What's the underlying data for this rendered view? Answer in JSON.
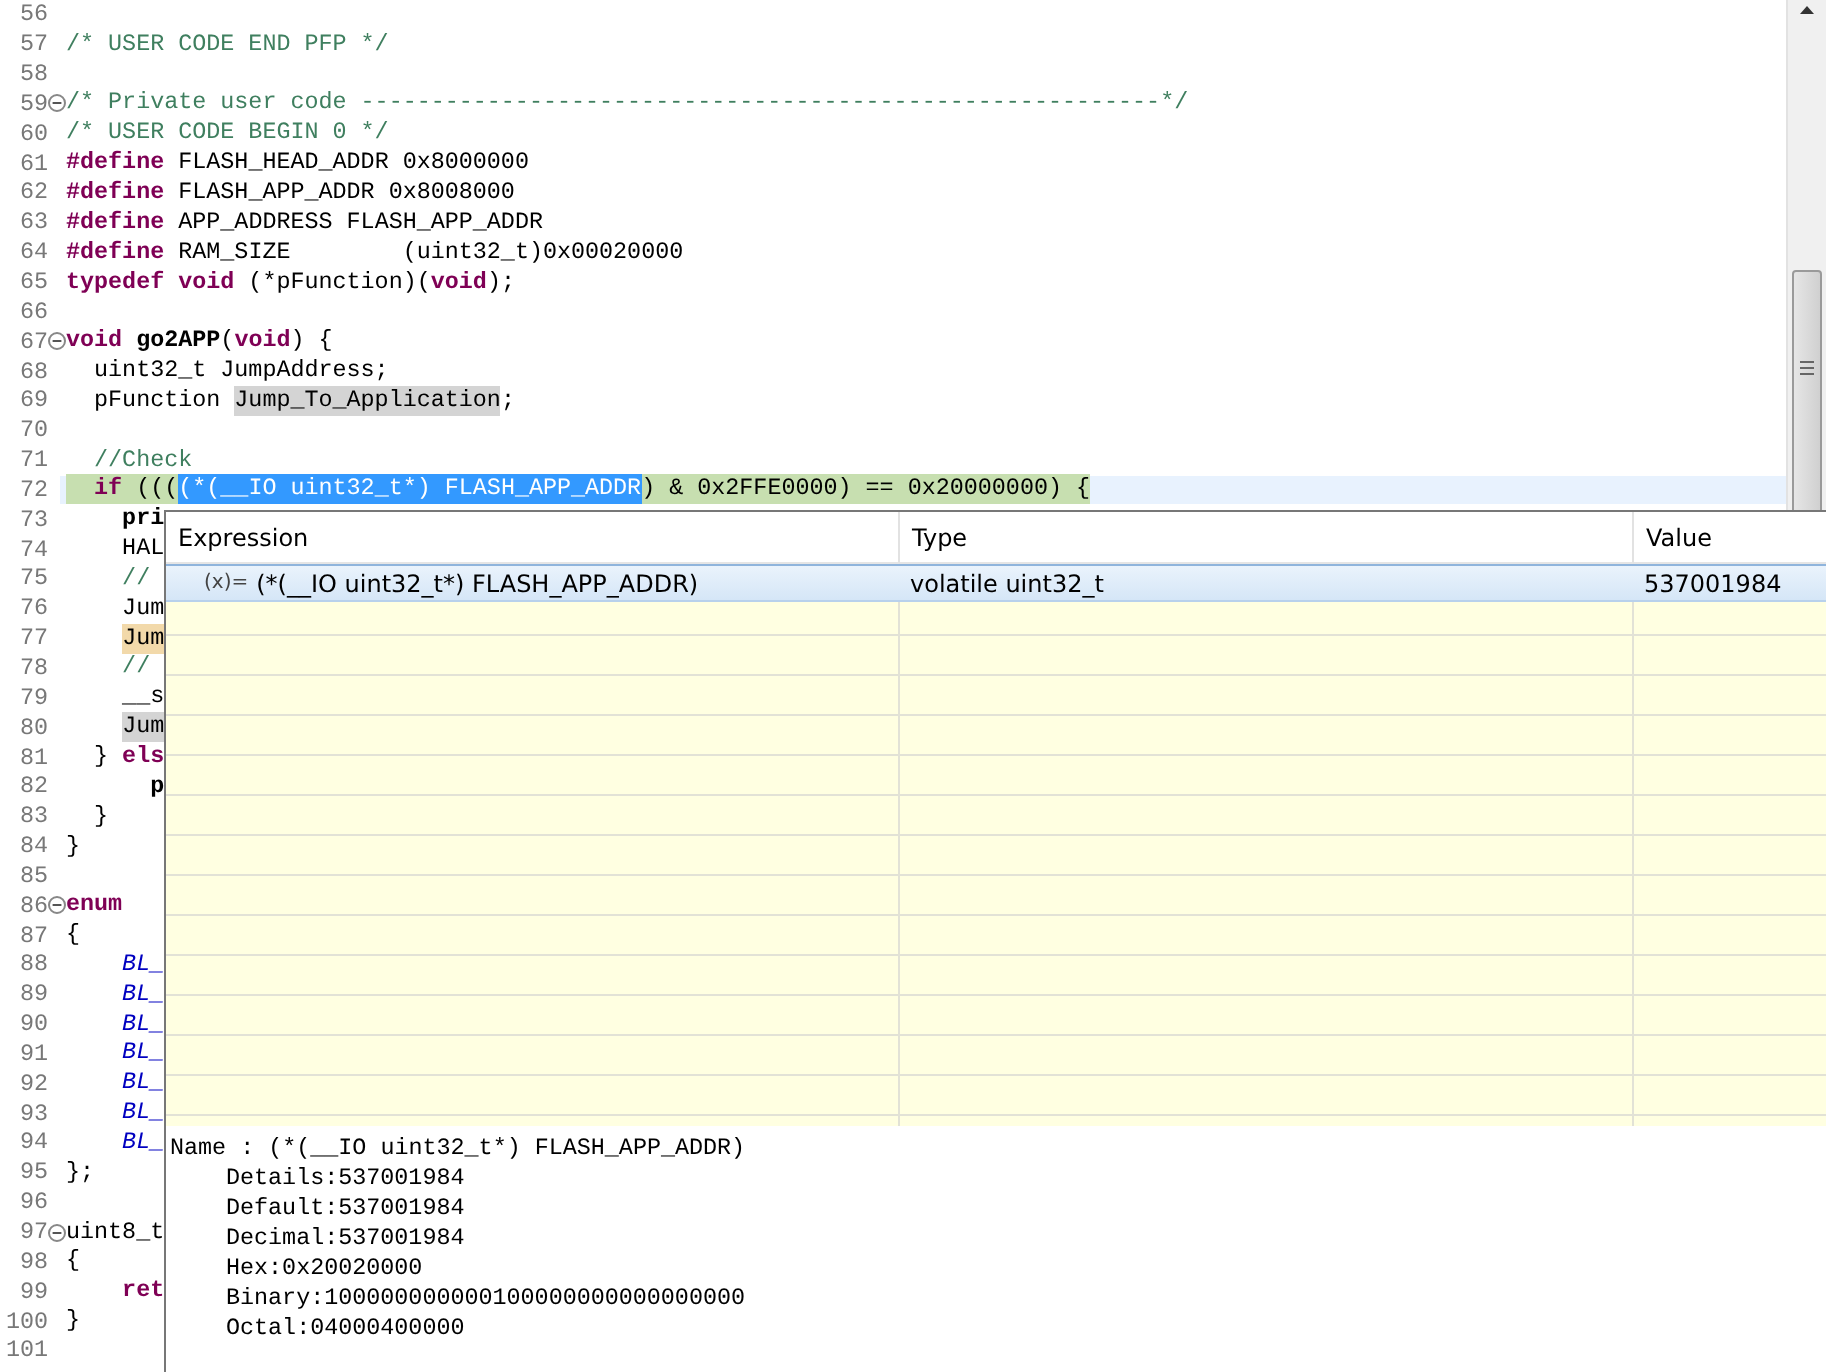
{
  "editor": {
    "lines": [
      {
        "number": "56",
        "fold": false,
        "current": false
      },
      {
        "number": "57",
        "fold": false,
        "current": false,
        "segments": [
          {
            "text": "/* USER CODE END PFP */",
            "kind": "comment"
          }
        ]
      },
      {
        "number": "58",
        "fold": false,
        "current": false
      },
      {
        "number": "59",
        "fold": true,
        "current": false,
        "segments": [
          {
            "text": "/* Private user code ---------------------------------------------------------*/",
            "kind": "comment"
          }
        ]
      },
      {
        "number": "60",
        "fold": false,
        "current": false,
        "segments": [
          {
            "text": "/* USER CODE BEGIN 0 */",
            "kind": "comment"
          }
        ]
      },
      {
        "number": "61",
        "fold": false,
        "current": false,
        "segments": [
          {
            "text": "#define",
            "kind": "keyword"
          },
          {
            "text": " FLASH_HEAD_ADDR 0x8000000",
            "kind": "plain"
          }
        ]
      },
      {
        "number": "62",
        "fold": false,
        "current": false,
        "segments": [
          {
            "text": "#define",
            "kind": "keyword"
          },
          {
            "text": " FLASH_APP_ADDR 0x8008000",
            "kind": "plain"
          }
        ]
      },
      {
        "number": "63",
        "fold": false,
        "current": false,
        "segments": [
          {
            "text": "#define",
            "kind": "keyword"
          },
          {
            "text": " APP_ADDRESS FLASH_APP_ADDR",
            "kind": "plain"
          }
        ]
      },
      {
        "number": "64",
        "fold": false,
        "current": false,
        "segments": [
          {
            "text": "#define",
            "kind": "keyword"
          },
          {
            "text": " RAM_SIZE        (uint32_t)0x00020000",
            "kind": "plain"
          }
        ]
      },
      {
        "number": "65",
        "fold": false,
        "current": false,
        "segments": [
          {
            "text": "typedef void",
            "kind": "keyword"
          },
          {
            "text": " (*pFunction)(",
            "kind": "plain"
          },
          {
            "text": "void",
            "kind": "keyword"
          },
          {
            "text": ");",
            "kind": "plain"
          }
        ]
      },
      {
        "number": "66",
        "fold": false,
        "current": false
      },
      {
        "number": "67",
        "fold": true,
        "current": false,
        "segments": [
          {
            "text": "void",
            "kind": "keyword"
          },
          {
            "text": " go2APP",
            "kind": "function"
          },
          {
            "text": "(",
            "kind": "plain"
          },
          {
            "text": "void",
            "kind": "keyword"
          },
          {
            "text": ") {",
            "kind": "plain"
          }
        ]
      },
      {
        "number": "68",
        "fold": false,
        "current": false,
        "segments": [
          {
            "text": "  uint32_t JumpAddress;",
            "kind": "plain"
          }
        ]
      },
      {
        "number": "69",
        "fold": false,
        "current": false,
        "segments": [
          {
            "text": "  pFunction ",
            "kind": "plain"
          },
          {
            "text": "Jump_To_Application",
            "kind": "plain",
            "occurrence": true
          },
          {
            "text": ";",
            "kind": "plain"
          }
        ]
      },
      {
        "number": "70",
        "fold": false,
        "current": false
      },
      {
        "number": "71",
        "fold": false,
        "current": false,
        "segments": [
          {
            "text": "  //Check",
            "kind": "comment"
          }
        ]
      },
      {
        "number": "72",
        "fold": false,
        "current": true,
        "segments": [
          {
            "text": "  if",
            "kind": "keyword",
            "matched": true
          },
          {
            "text": " (((",
            "kind": "plain",
            "matched": true
          },
          {
            "text": "(*(__IO uint32_t*) FLASH_APP_ADDR",
            "kind": "plain",
            "selected": true
          },
          {
            "text": ") & 0x2FFE0000) == 0x20000000) {",
            "kind": "plain",
            "matched": true
          }
        ]
      },
      {
        "number": "73",
        "fold": false,
        "current": false,
        "segments": [
          {
            "text": "    pri",
            "kind": "function"
          }
        ]
      },
      {
        "number": "74",
        "fold": false,
        "current": false,
        "segments": [
          {
            "text": "    HAL",
            "kind": "plain"
          }
        ]
      },
      {
        "number": "75",
        "fold": false,
        "current": false,
        "segments": [
          {
            "text": "    //",
            "kind": "comment"
          }
        ]
      },
      {
        "number": "76",
        "fold": false,
        "current": false,
        "segments": [
          {
            "text": "    Jum",
            "kind": "plain"
          }
        ]
      },
      {
        "number": "77",
        "fold": false,
        "current": false,
        "segments": [
          {
            "text": "    Jum",
            "kind": "plain",
            "write_access": true
          }
        ]
      },
      {
        "number": "78",
        "fold": false,
        "current": false,
        "segments": [
          {
            "text": "    //",
            "kind": "comment"
          }
        ]
      },
      {
        "number": "79",
        "fold": false,
        "current": false,
        "segments": [
          {
            "text": "    __s",
            "kind": "plain"
          }
        ]
      },
      {
        "number": "80",
        "fold": false,
        "current": false,
        "segments": [
          {
            "text": "    Jum",
            "kind": "plain",
            "occurrence": true
          }
        ]
      },
      {
        "number": "81",
        "fold": false,
        "current": false,
        "segments": [
          {
            "text": "  }",
            "kind": "plain"
          },
          {
            "text": " els",
            "kind": "keyword"
          }
        ]
      },
      {
        "number": "82",
        "fold": false,
        "current": false,
        "segments": [
          {
            "text": "      p",
            "kind": "function"
          }
        ]
      },
      {
        "number": "83",
        "fold": false,
        "current": false,
        "segments": [
          {
            "text": "  }",
            "kind": "plain"
          }
        ]
      },
      {
        "number": "84",
        "fold": false,
        "current": false,
        "segments": [
          {
            "text": "}",
            "kind": "plain"
          }
        ]
      },
      {
        "number": "85",
        "fold": false,
        "current": false
      },
      {
        "number": "86",
        "fold": true,
        "current": false,
        "segments": [
          {
            "text": "enum",
            "kind": "keyword"
          }
        ]
      },
      {
        "number": "87",
        "fold": false,
        "current": false,
        "segments": [
          {
            "text": "{",
            "kind": "plain"
          }
        ]
      },
      {
        "number": "88",
        "fold": false,
        "current": false,
        "segments": [
          {
            "text": "    BL_",
            "kind": "enumerator"
          }
        ]
      },
      {
        "number": "89",
        "fold": false,
        "current": false,
        "segments": [
          {
            "text": "    BL_",
            "kind": "enumerator"
          }
        ]
      },
      {
        "number": "90",
        "fold": false,
        "current": false,
        "segments": [
          {
            "text": "    BL_",
            "kind": "enumerator"
          }
        ]
      },
      {
        "number": "91",
        "fold": false,
        "current": false,
        "segments": [
          {
            "text": "    BL_",
            "kind": "enumerator"
          }
        ]
      },
      {
        "number": "92",
        "fold": false,
        "current": false,
        "segments": [
          {
            "text": "    BL_",
            "kind": "enumerator"
          }
        ]
      },
      {
        "number": "93",
        "fold": false,
        "current": false,
        "segments": [
          {
            "text": "    BL_",
            "kind": "enumerator"
          }
        ]
      },
      {
        "number": "94",
        "fold": false,
        "current": false,
        "segments": [
          {
            "text": "    BL_",
            "kind": "enumerator"
          }
        ]
      },
      {
        "number": "95",
        "fold": false,
        "current": false,
        "segments": [
          {
            "text": "};",
            "kind": "plain"
          }
        ]
      },
      {
        "number": "96",
        "fold": false,
        "current": false
      },
      {
        "number": "97",
        "fold": true,
        "current": false,
        "segments": [
          {
            "text": "uint8_t",
            "kind": "plain"
          }
        ]
      },
      {
        "number": "98",
        "fold": false,
        "current": false,
        "segments": [
          {
            "text": "{",
            "kind": "plain"
          }
        ]
      },
      {
        "number": "99",
        "fold": false,
        "current": false,
        "segments": [
          {
            "text": "    ret",
            "kind": "keyword"
          }
        ]
      },
      {
        "number": "100",
        "fold": false,
        "current": false,
        "segments": [
          {
            "text": "}",
            "kind": "plain"
          }
        ]
      },
      {
        "number": "101",
        "fold": false,
        "current": false
      }
    ]
  },
  "hover": {
    "columns": [
      "Expression",
      "Type",
      "Value"
    ],
    "rows": [
      {
        "icon": "(x)=",
        "expression": "(*(__IO uint32_t*) FLASH_APP_ADDR)",
        "type": "volatile uint32_t",
        "value": "537001984",
        "selected": true
      }
    ],
    "details": {
      "name": "Name : (*(__IO uint32_t*) FLASH_APP_ADDR)",
      "fields": [
        "Details:537001984",
        "Default:537001984",
        "Decimal:537001984",
        "Hex:0x20020000",
        "Binary:100000000000100000000000000000",
        "Octal:04000400000"
      ]
    }
  }
}
